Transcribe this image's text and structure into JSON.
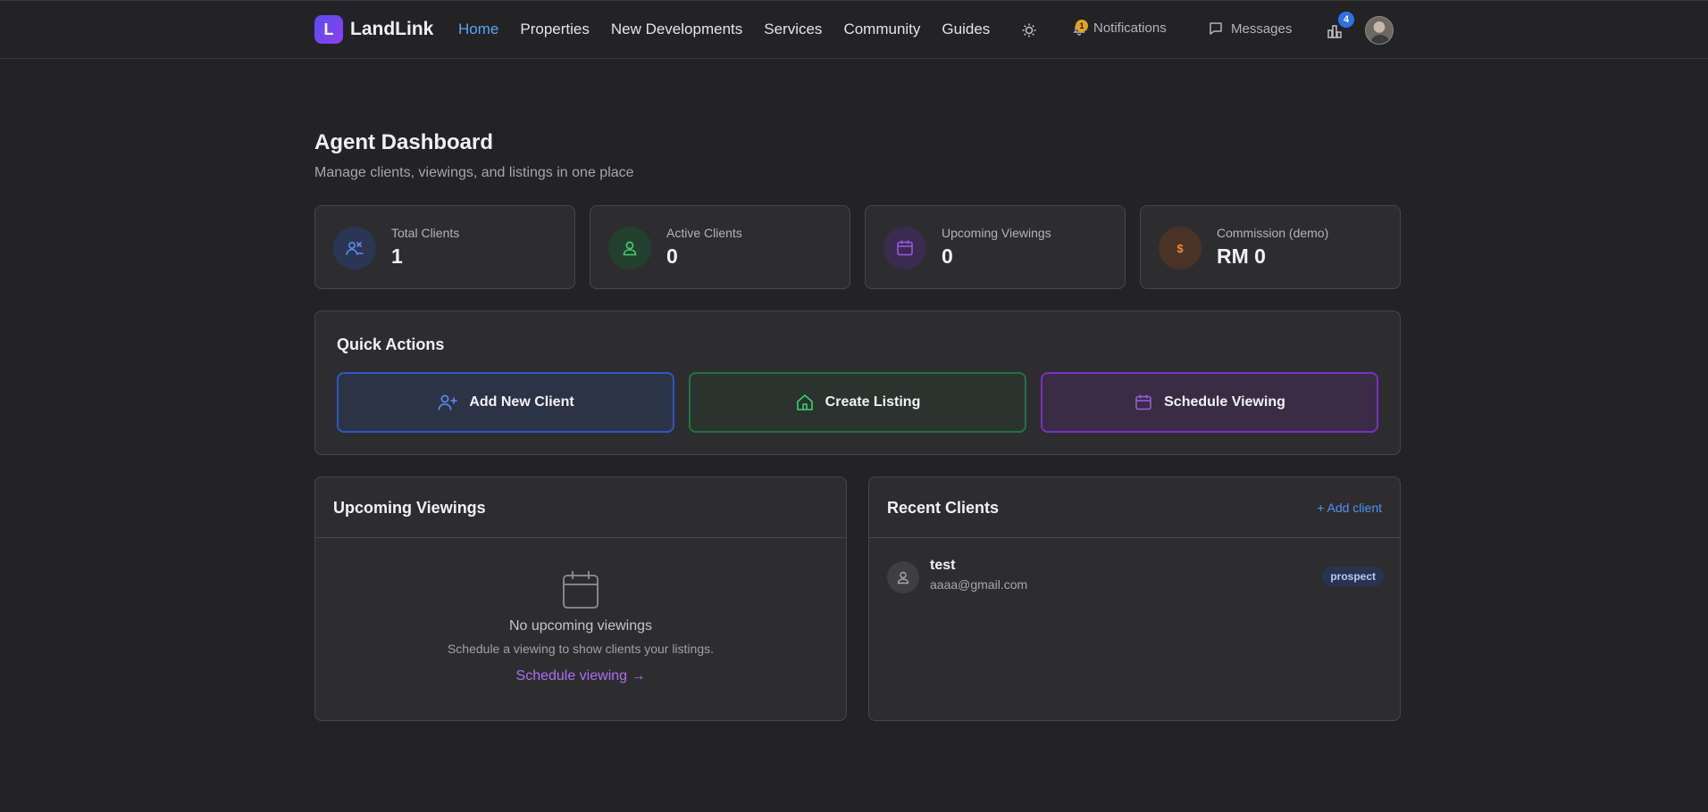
{
  "header": {
    "logo_letter": "L",
    "brand": "LandLink",
    "nav": [
      {
        "label": "Home",
        "active": true
      },
      {
        "label": "Properties"
      },
      {
        "label": "New Developments"
      },
      {
        "label": "Services"
      },
      {
        "label": "Community"
      },
      {
        "label": "Guides"
      }
    ],
    "notifications_label": "Notifications",
    "notifications_count": "1",
    "messages_label": "Messages",
    "compare_count": "4"
  },
  "page": {
    "title": "Agent Dashboard",
    "subtitle": "Manage clients, viewings, and listings in one place"
  },
  "stats": [
    {
      "label": "Total Clients",
      "value": "1",
      "icon": "users-icon",
      "color": "#5a8ef0"
    },
    {
      "label": "Active Clients",
      "value": "0",
      "icon": "user-check-icon",
      "color": "#3fcf73"
    },
    {
      "label": "Upcoming Viewings",
      "value": "0",
      "icon": "calendar-icon",
      "color": "#9b5ce6"
    },
    {
      "label": "Commission (demo)",
      "value": "RM 0",
      "icon": "dollar-icon",
      "icon_text": "$",
      "color": "#f08a3c"
    }
  ],
  "quick_actions": {
    "title": "Quick Actions",
    "buttons": [
      {
        "label": "Add New Client",
        "icon": "user-plus-icon"
      },
      {
        "label": "Create Listing",
        "icon": "home-icon"
      },
      {
        "label": "Schedule Viewing",
        "icon": "calendar-icon"
      }
    ]
  },
  "viewings": {
    "title": "Upcoming Viewings",
    "empty_title": "No upcoming viewings",
    "empty_sub": "Schedule a viewing to show clients your listings.",
    "empty_link": "Schedule viewing →"
  },
  "clients": {
    "title": "Recent Clients",
    "add_link": "+ Add client",
    "list": [
      {
        "name": "test",
        "email": "aaaa@gmail.com",
        "status": "prospect"
      }
    ]
  }
}
